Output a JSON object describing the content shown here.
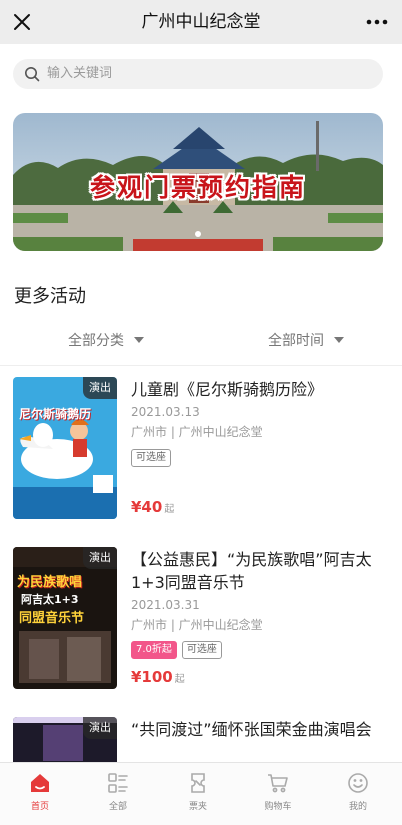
{
  "header": {
    "title": "广州中山纪念堂",
    "close_icon": "close-icon",
    "more_icon": "more-dots-icon"
  },
  "search": {
    "placeholder": "输入关键词",
    "icon": "search-icon"
  },
  "banner": {
    "caption": "参观门票预约指南",
    "active_dot": 0,
    "dot_count": 1
  },
  "section": {
    "title": "更多活动"
  },
  "filters": {
    "category": "全部分类",
    "time": "全部时间"
  },
  "events": [
    {
      "badge": "演出",
      "name": "儿童剧《尼尔斯骑鹅历险》",
      "date": "2021.03.13",
      "venue": "广州市 | 广州中山纪念堂",
      "tags": [
        "可选座"
      ],
      "price": "¥40",
      "price_suffix": "起",
      "poster_text": "尼尔斯骑鹅历"
    },
    {
      "badge": "演出",
      "name": "【公益惠民】“为民族歌唱”阿吉太1+3同盟音乐节",
      "date": "2021.03.31",
      "venue": "广州市 | 广州中山纪念堂",
      "discount_tag": "7.0折起",
      "tags": [
        "可选座"
      ],
      "price": "¥100",
      "price_suffix": "起",
      "poster_text_1": "为民族歌唱",
      "poster_text_2": "阿吉太1+3",
      "poster_text_3": "同盟音乐节"
    },
    {
      "badge": "演出",
      "name": "“共同渡过”缅怀张国荣金曲演唱会"
    }
  ],
  "tabbar": {
    "items": [
      {
        "label": "首页",
        "icon": "home-icon",
        "active": true
      },
      {
        "label": "全部",
        "icon": "grid-list-icon",
        "active": false
      },
      {
        "label": "票夹",
        "icon": "ticket-icon",
        "active": false
      },
      {
        "label": "购物车",
        "icon": "cart-icon",
        "active": false
      },
      {
        "label": "我的",
        "icon": "smile-user-icon",
        "active": false
      }
    ]
  },
  "colors": {
    "accent": "#e53a3a",
    "discount": "#f2568a",
    "header_bg": "#ededed"
  }
}
